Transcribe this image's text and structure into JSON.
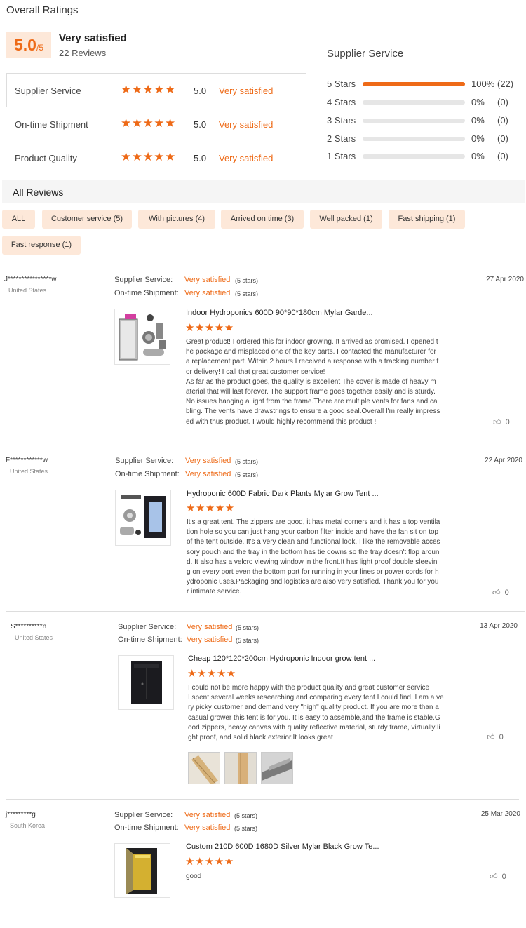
{
  "overall": {
    "title": "Overall Ratings",
    "score": "5.0",
    "score_suffix": "/5",
    "score_label": "Very satisfied",
    "reviews_count": "22 Reviews"
  },
  "summary_rows": [
    {
      "name": "Supplier Service",
      "value": "5.0",
      "label": "Very satisfied"
    },
    {
      "name": "On-time Shipment",
      "value": "5.0",
      "label": "Very satisfied"
    },
    {
      "name": "Product Quality",
      "value": "5.0",
      "label": "Very satisfied"
    }
  ],
  "stars_glyph": "★★★★★",
  "supplier_breakdown": {
    "title": "Supplier Service",
    "rows": [
      {
        "label": "5  Stars",
        "fraction": 1.0,
        "pct": "100%",
        "count": "(22)"
      },
      {
        "label": "4  Stars",
        "fraction": 0.0,
        "pct": "0%",
        "count": "(0)"
      },
      {
        "label": "3  Stars",
        "fraction": 0.0,
        "pct": "0%",
        "count": "(0)"
      },
      {
        "label": "2  Stars",
        "fraction": 0.0,
        "pct": "0%",
        "count": "(0)"
      },
      {
        "label": "1  Stars",
        "fraction": 0.0,
        "pct": "0%",
        "count": "(0)"
      }
    ]
  },
  "all_reviews": {
    "title": "All Reviews",
    "filters": [
      "ALL",
      "Customer service (5)",
      "With pictures (4)",
      "Arrived on time (3)",
      "Well packed (1)",
      "Fast shipping (1)",
      "Fast response (1)"
    ]
  },
  "labels": {
    "supplier": "Supplier Service:",
    "shipment": "On-time Shipment:",
    "very_satisfied": "Very satisfied",
    "five_stars": "(5 stars)"
  },
  "reviews": [
    {
      "name": "J****************w",
      "country": "United States",
      "date": "27 Apr 2020",
      "product": "Indoor Hydroponics 600D 90*90*180cm Mylar Garde...",
      "text": "Great product! I ordered this for indoor growing. It arrived as promised. I opened t\nhe package and misplaced one of the key parts. I contacted the manufacturer for\na replacement part. Within 2 hours I received a response with a tracking number f\nor delivery! I call that great customer service!\nAs far as the product goes, the quality is excellent  The cover is made of heavy m\naterial that will last forever. The support frame goes together easily and is sturdy.\nNo issues hanging a light from the frame.There are multiple vents for fans and ca\nbling. The vents have drawstrings to ensure a good seal.Overall I'm really impress\ned with thus product. I would highly recommend this product !",
      "likes": "0"
    },
    {
      "name": "F************w",
      "country": "United States",
      "date": "22 Apr 2020",
      "product": "Hydroponic 600D Fabric Dark Plants Mylar Grow Tent ...",
      "text": "It's a great tent. The zippers are good, it has metal corners and it has a top ventila\ntion hole so you can just hang your carbon filter inside and have the fan sit on top\nof the tent outside. It's a very clean and functional look. I like the removable acces\nsory pouch and the tray in the bottom has tie downs so the tray doesn't flop aroun\nd. It also has a velcro viewing window in the front.It has light proof double sleevin\ng on every port even the bottom port for running in your lines or power cords for h\nydroponic uses.Packaging and logistics are also very satisfied. Thank you for you\nr intimate service.",
      "likes": "0"
    },
    {
      "name": "S**********n",
      "country": "United States",
      "date": "13 Apr 2020",
      "product": "Cheap 120*120*200cm Hydroponic Indoor grow tent ...",
      "text": "I could not be more happy with the product quality and great customer service\nI spent several weeks researching and comparing every tent I could find. I am a ve\nry picky customer and demand very \"high\" quality product. If you are more than a\ncasual grower this tent is for you. It is easy to assemble,and the frame is stable.G\nood zippers, heavy canvas with quality reflective material, sturdy frame, virtually li\nght proof, and solid black exterior.It looks great",
      "likes": "0"
    },
    {
      "name": "j*********g",
      "country": "South Korea",
      "date": "25 Mar 2020",
      "product": "Custom 210D 600D 1680D Silver Mylar Black Grow Te...",
      "text": "good",
      "likes": "0"
    }
  ]
}
